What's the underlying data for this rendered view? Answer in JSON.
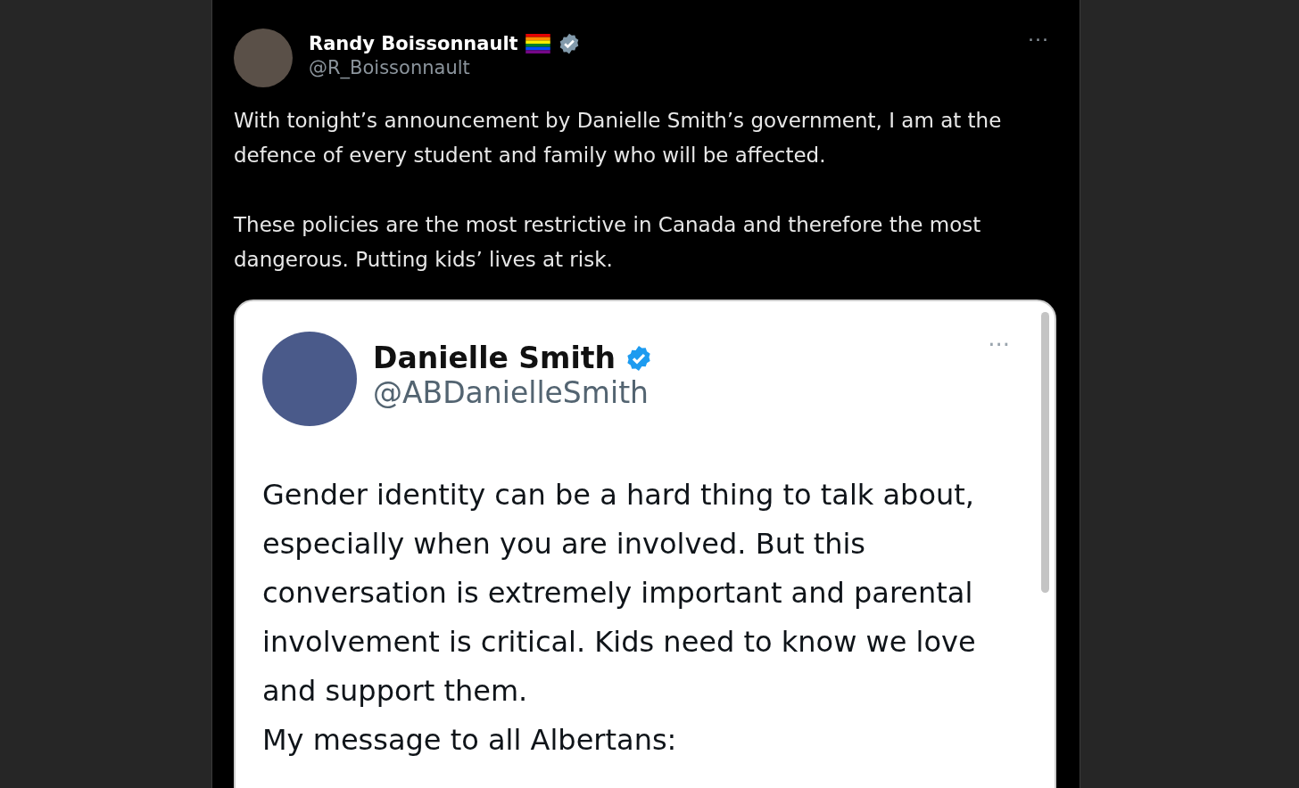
{
  "post": {
    "author": {
      "name": "Randy Boissonnault",
      "handle": "@R_Boissonnault"
    },
    "paragraphs": [
      "With tonight’s announcement by Danielle Smith’s government, I am at the defence of every student and family who will be affected.",
      "These policies are the most restrictive in Canada and therefore the most dangerous. Putting kids’ lives at risk."
    ],
    "more": "···",
    "quoted": {
      "author": {
        "name": "Danielle Smith",
        "handle": "@ABDanielleSmith"
      },
      "more": "···",
      "lines": [
        "Gender identity can be a hard thing to talk about, especially when you are involved. But this conversation is extremely important and parental involvement is critical. Kids need to know we love and support them.",
        "My message to all Albertans:"
      ]
    }
  }
}
